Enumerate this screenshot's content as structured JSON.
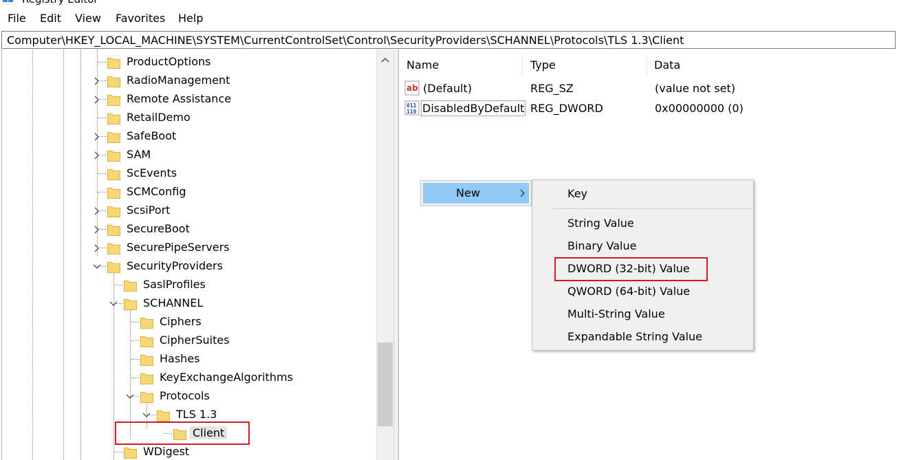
{
  "window": {
    "title": "Registry Editor"
  },
  "menu": [
    "File",
    "Edit",
    "View",
    "Favorites",
    "Help"
  ],
  "address": "Computer\\HKEY_LOCAL_MACHINE\\SYSTEM\\CurrentControlSet\\Control\\SecurityProviders\\SCHANNEL\\Protocols\\TLS 1.3\\Client",
  "tree": {
    "items": [
      {
        "label": "ProductOptions",
        "chevron": "none"
      },
      {
        "label": "RadioManagement",
        "chevron": "collapsed"
      },
      {
        "label": "Remote Assistance",
        "chevron": "collapsed"
      },
      {
        "label": "RetailDemo",
        "chevron": "none"
      },
      {
        "label": "SafeBoot",
        "chevron": "collapsed"
      },
      {
        "label": "SAM",
        "chevron": "collapsed"
      },
      {
        "label": "ScEvents",
        "chevron": "none"
      },
      {
        "label": "SCMConfig",
        "chevron": "none"
      },
      {
        "label": "ScsiPort",
        "chevron": "collapsed"
      },
      {
        "label": "SecureBoot",
        "chevron": "collapsed"
      },
      {
        "label": "SecurePipeServers",
        "chevron": "collapsed"
      },
      {
        "label": "SecurityProviders",
        "chevron": "expanded"
      },
      {
        "label": "SaslProfiles",
        "chevron": "none"
      },
      {
        "label": "SCHANNEL",
        "chevron": "expanded"
      },
      {
        "label": "Ciphers",
        "chevron": "none"
      },
      {
        "label": "CipherSuites",
        "chevron": "none"
      },
      {
        "label": "Hashes",
        "chevron": "none"
      },
      {
        "label": "KeyExchangeAlgorithms",
        "chevron": "none"
      },
      {
        "label": "Protocols",
        "chevron": "expanded"
      },
      {
        "label": "TLS 1.3",
        "chevron": "expanded"
      },
      {
        "label": "Client",
        "chevron": "none",
        "selected": true
      },
      {
        "label": "WDigest",
        "chevron": "none"
      }
    ]
  },
  "list": {
    "columns": [
      "Name",
      "Type",
      "Data"
    ],
    "rows": [
      {
        "icon": "string-value-icon",
        "name": "(Default)",
        "type": "REG_SZ",
        "data": "(value not set)"
      },
      {
        "icon": "binary-value-icon",
        "name": "DisabledByDefault",
        "type": "REG_DWORD",
        "data": "0x00000000 (0)"
      }
    ]
  },
  "context_menu": {
    "new_label": "New",
    "submenu": [
      "Key",
      "String Value",
      "Binary Value",
      "DWORD (32-bit) Value",
      "QWORD (64-bit) Value",
      "Multi-String Value",
      "Expandable String Value"
    ]
  },
  "colors": {
    "highlight": "#91c9f7",
    "annotation": "#d11b24",
    "folder": "#f8d775"
  }
}
